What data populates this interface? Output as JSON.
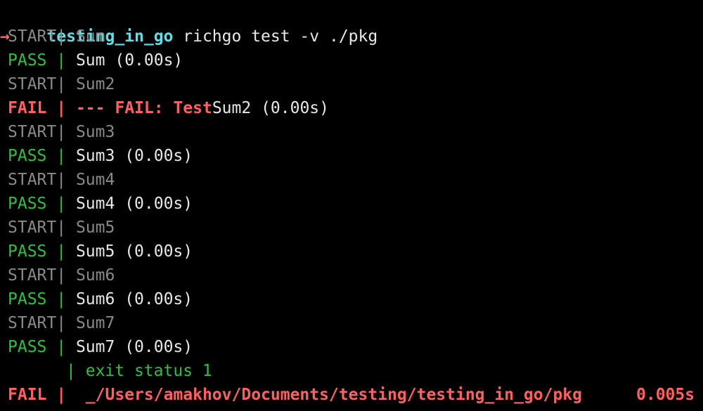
{
  "prompt": {
    "arrow": "→",
    "directory": "testing_in_go",
    "command": "richgo test -v ./pkg"
  },
  "labels": {
    "start": "START|",
    "pass": "PASS |",
    "fail": "FAIL |",
    "continuation": "|"
  },
  "tests": [
    {
      "start_name": "Sum",
      "result": "pass",
      "result_text": "Sum (0.00s)"
    },
    {
      "start_name": "Sum2",
      "result": "fail",
      "fail_prefix": "--- FAIL: Test",
      "fail_suffix": "Sum2 (0.00s)"
    },
    {
      "start_name": "Sum3",
      "result": "pass",
      "result_text": "Sum3 (0.00s)"
    },
    {
      "start_name": "Sum4",
      "result": "pass",
      "result_text": "Sum4 (0.00s)"
    },
    {
      "start_name": "Sum5",
      "result": "pass",
      "result_text": "Sum5 (0.00s)"
    },
    {
      "start_name": "Sum6",
      "result": "pass",
      "result_text": "Sum6 (0.00s)"
    },
    {
      "start_name": "Sum7",
      "result": "pass",
      "result_text": "Sum7 (0.00s)"
    }
  ],
  "exit_status": "exit status 1",
  "summary": {
    "package_path": "_/Users/amakhov/Documents/testing/testing_in_go/pkg",
    "time": "0.005s"
  },
  "colors": {
    "background": "#000000",
    "text": "#e8e8e8",
    "muted": "#8a8a8a",
    "pass": "#29c33d",
    "fail": "#ff5f63",
    "prompt_dir": "#5ee0e6"
  }
}
